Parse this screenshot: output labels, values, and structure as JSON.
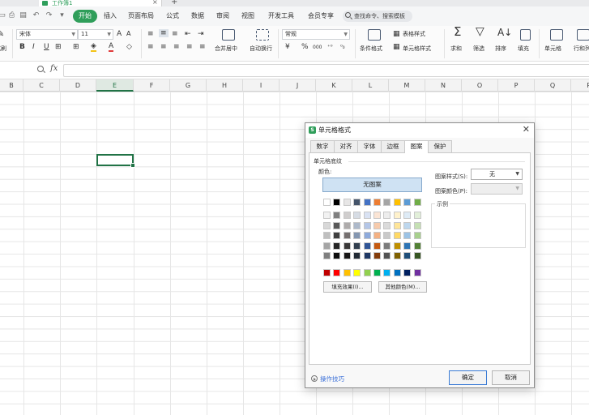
{
  "document": {
    "tab_title": "工作簿1"
  },
  "menu": {
    "items": [
      "开始",
      "插入",
      "页面布局",
      "公式",
      "数据",
      "审阅",
      "视图",
      "开发工具",
      "会员专享"
    ],
    "search_placeholder": "查找命令、搜索模板"
  },
  "ribbon": {
    "font_name": "宋体",
    "font_size": "11",
    "number_format": "常规",
    "labels": {
      "merge_center": "合并居中",
      "wrap_text": "自动换行",
      "conditional_format": "条件格式",
      "table_style": "表格样式",
      "cell_style": "单元格样式",
      "sum": "求和",
      "filter": "筛选",
      "sort": "排序",
      "fill": "填充",
      "cell": "单元格",
      "row_col": "行和列",
      "paste": "式刷"
    },
    "number_symbols": {
      "currency": "¥",
      "percent": "%",
      "thousands": "000"
    }
  },
  "formula_bar": {
    "fx_label": "fx",
    "value": ""
  },
  "grid": {
    "columns": [
      "B",
      "C",
      "D",
      "E",
      "F",
      "G",
      "H",
      "I",
      "J",
      "K",
      "L",
      "M",
      "N",
      "O",
      "P",
      "Q",
      "R"
    ],
    "selected_column": "E"
  },
  "dialog": {
    "title": "单元格格式",
    "tabs": [
      "数字",
      "对齐",
      "字体",
      "边框",
      "图案",
      "保护"
    ],
    "active_tab": "图案",
    "group_label": "单元格底纹",
    "color_label": "颜色:",
    "no_pattern_label": "无图案",
    "palette": {
      "row_main": [
        "#ffffff",
        "#000000",
        "#e7e6e6",
        "#44546a",
        "#4472c4",
        "#ed7d31",
        "#a5a5a5",
        "#ffc000",
        "#5b9bd5",
        "#70ad47"
      ],
      "rows_tints": [
        [
          "#f2f2f2",
          "#7f7f7f",
          "#d0cece",
          "#d6dce4",
          "#d9e2f3",
          "#fbe5d5",
          "#ededed",
          "#fff2cc",
          "#deebf6",
          "#e2efd9"
        ],
        [
          "#d8d8d8",
          "#595959",
          "#aeabab",
          "#adb9ca",
          "#b4c6e7",
          "#f7cbac",
          "#dbdbdb",
          "#fee599",
          "#bdd7ee",
          "#c5e0b3"
        ],
        [
          "#bfbfbf",
          "#3f3f3f",
          "#757070",
          "#8496b0",
          "#8eaadb",
          "#f4b183",
          "#c9c9c9",
          "#ffd965",
          "#9cc3e5",
          "#a8d08d"
        ],
        [
          "#a5a5a5",
          "#262626",
          "#3a3838",
          "#323f4f",
          "#2f5496",
          "#c55a11",
          "#7b7b7b",
          "#bf8f00",
          "#2e75b5",
          "#538135"
        ],
        [
          "#7f7f7f",
          "#0c0c0c",
          "#171616",
          "#222a35",
          "#1f3864",
          "#833c0b",
          "#525252",
          "#7f6000",
          "#1e4e79",
          "#375623"
        ]
      ],
      "row_standard": [
        "#c00000",
        "#ff0000",
        "#ffc000",
        "#ffff00",
        "#92d050",
        "#00b050",
        "#00b0f0",
        "#0070c0",
        "#002060",
        "#7030a0"
      ]
    },
    "fill_effects_label": "填充效果(I)...",
    "more_colors_label": "其他颜色(M)...",
    "pattern_style_label": "图案样式(S):",
    "pattern_style_value": "无",
    "pattern_color_label": "图案颜色(P):",
    "pattern_color_value": "",
    "sample_label": "示例",
    "tips_label": "操作技巧",
    "ok_label": "确定",
    "cancel_label": "取消"
  },
  "colors": {
    "accent_green": "#2f9e5a",
    "selection_green": "#217346",
    "link_blue": "#3a6fd8"
  }
}
